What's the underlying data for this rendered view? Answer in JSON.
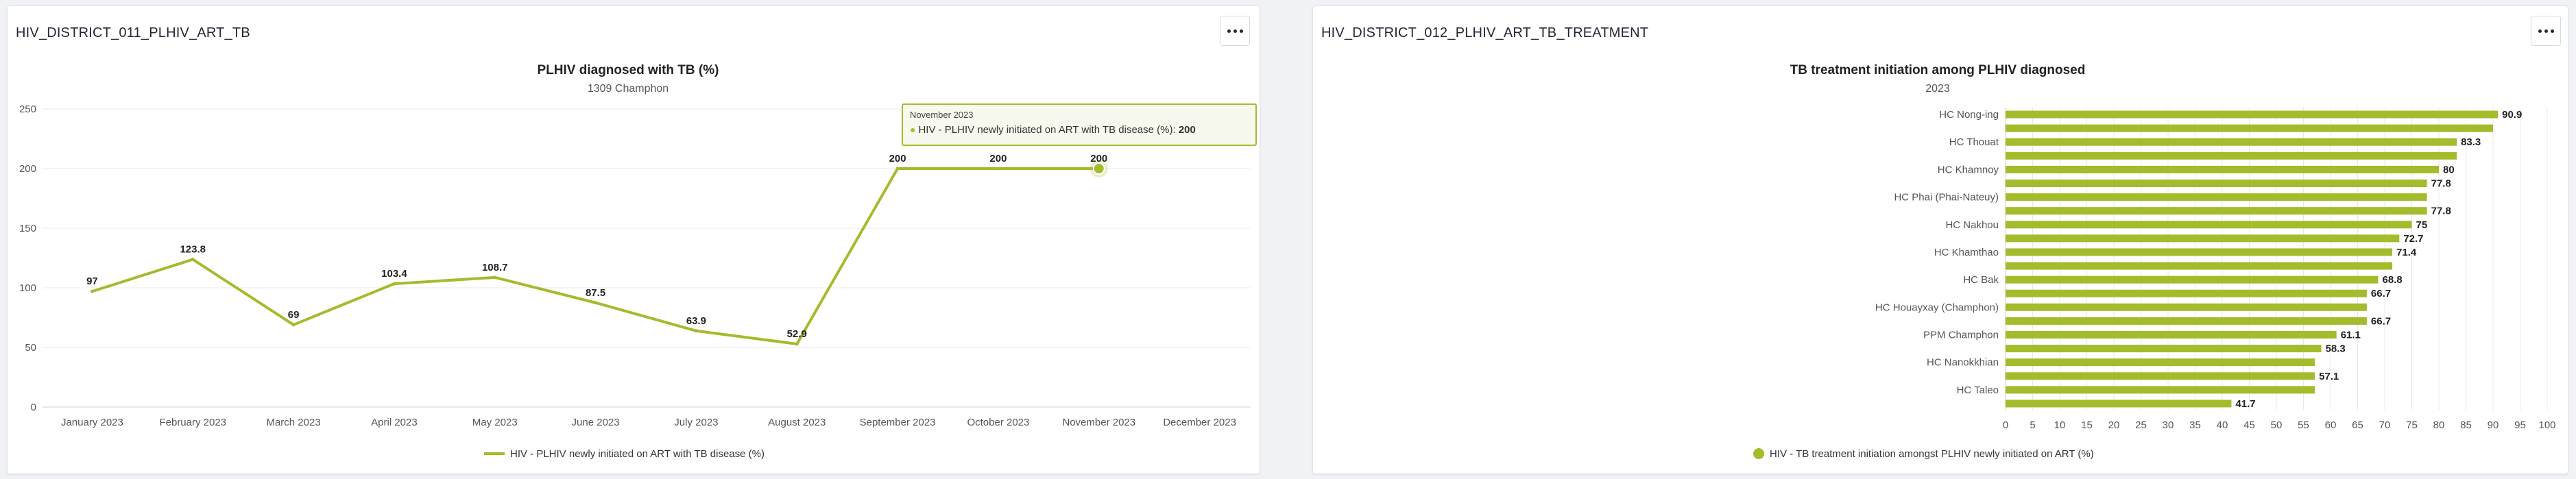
{
  "left_panel": {
    "title": "HIV_DISTRICT_011_PLHIV_ART_TB",
    "menu_label": "More options",
    "tooltip": {
      "date": "November 2023",
      "series": "HIV - PLHIV newly initiated on ART with TB disease (%)",
      "value": "200"
    }
  },
  "right_panel": {
    "title": "HIV_DISTRICT_012_PLHIV_ART_TB_TREATMENT",
    "menu_label": "More options"
  },
  "colors": {
    "series": "#a2bc2c",
    "grid": "#e8e8e8",
    "axis_text": "#555555"
  },
  "chart_data": [
    {
      "type": "line",
      "title": "PLHIV diagnosed with TB (%)",
      "subtitle": "1309 Champhon",
      "categories": [
        "January 2023",
        "February 2023",
        "March 2023",
        "April 2023",
        "May 2023",
        "June 2023",
        "July 2023",
        "August 2023",
        "September 2023",
        "October 2023",
        "November 2023",
        "December 2023"
      ],
      "series": [
        {
          "name": "HIV - PLHIV newly initiated on ART with TB disease (%)",
          "values": [
            97,
            123.8,
            69,
            103.4,
            108.7,
            87.5,
            63.9,
            52.9,
            200,
            200,
            200,
            null
          ]
        }
      ],
      "data_labels": [
        "97",
        "123.8",
        "69",
        "103.4",
        "108.7",
        "87.5",
        "63.9",
        "52.9",
        "200",
        "200",
        "200",
        ""
      ],
      "ylim": [
        0,
        250
      ],
      "yticks": [
        0,
        50,
        100,
        150,
        200,
        250
      ],
      "grid": true,
      "legend_position": "bottom",
      "highlighted_point": "November 2023"
    },
    {
      "type": "bar",
      "orientation": "horizontal",
      "title": "TB treatment initiation among PLHIV diagnosed",
      "subtitle": "2023",
      "category_labels": [
        "HC Nong-ing",
        "",
        "HC Thouat",
        "",
        "HC Khamnoy",
        "",
        "HC Phai (Phai-Nateuy)",
        "",
        "HC Nakhou",
        "",
        "HC Khamthao",
        "",
        "HC Bak",
        "",
        "HC Houayxay (Champhon)",
        "",
        "PPM Champhon",
        "",
        "HC Nanokkhian",
        "",
        "HC Taleo",
        ""
      ],
      "series": [
        {
          "name": "HIV - TB treatment initiation amongst PLHIV newly initiated on ART (%)",
          "values": [
            90.9,
            90,
            83.3,
            83.3,
            80,
            77.8,
            77.8,
            77.8,
            75,
            72.7,
            71.4,
            71.4,
            68.8,
            66.7,
            66.7,
            66.7,
            61.1,
            58.3,
            57.1,
            57.1,
            57.1,
            41.7
          ]
        }
      ],
      "data_labels": [
        "90.9",
        "",
        "83.3",
        "",
        "80",
        "77.8",
        "",
        "77.8",
        "75",
        "72.7",
        "71.4",
        "",
        "68.8",
        "66.7",
        "",
        "66.7",
        "61.1",
        "58.3",
        "",
        "57.1",
        "",
        "41.7"
      ],
      "xlim": [
        0,
        100
      ],
      "xticks": [
        0,
        5,
        10,
        15,
        20,
        25,
        30,
        35,
        40,
        45,
        50,
        55,
        60,
        65,
        70,
        75,
        80,
        85,
        90,
        95,
        100
      ],
      "grid": true,
      "legend_position": "bottom"
    }
  ]
}
